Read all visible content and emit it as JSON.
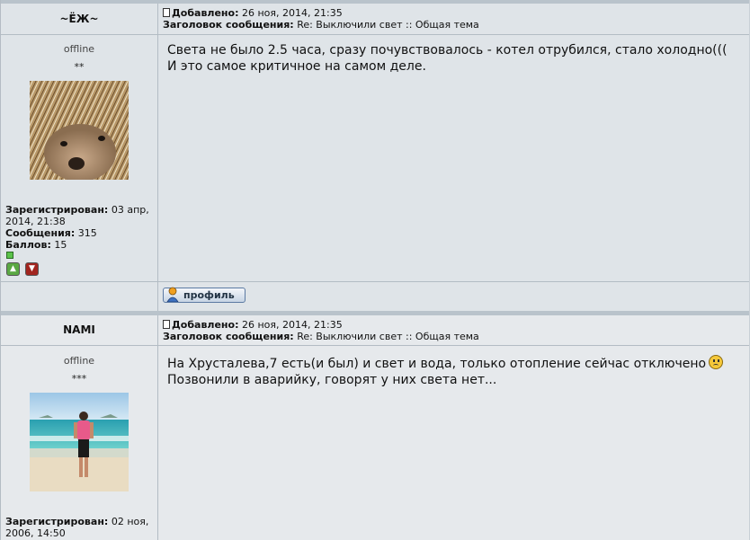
{
  "posts": [
    {
      "author": "~ЁЖ~",
      "status": "offline",
      "rank": "**",
      "added_label": "Добавлено:",
      "added_value": "26 ноя, 2014, 21:35",
      "subject_label": "Заголовок сообщения:",
      "subject_value": "Re: Выключили свет :: Общая тема",
      "body_lines": [
        "Света не было 2.5 часа, сразу почувствовалось - котел отрубился, стало холодно(((",
        "И это самое критичное на самом деле."
      ],
      "registered_label": "Зарегистрирован:",
      "registered_value": "03 апр, 2014, 21:38",
      "messages_label": "Сообщения:",
      "messages_value": "315",
      "points_label": "Баллов:",
      "points_value": "15",
      "profile_button": "профиль"
    },
    {
      "author": "NAMI",
      "status": "offline",
      "rank": "***",
      "added_label": "Добавлено:",
      "added_value": "26 ноя, 2014, 21:35",
      "subject_label": "Заголовок сообщения:",
      "subject_value": "Re: Выключили свет :: Общая тема",
      "body_lines": [
        "На Хрусталева,7 есть(и был) и свет и вода, только отопление сейчас отключено",
        "Позвонили в аварийку, говорят у них света нет..."
      ],
      "registered_label": "Зарегистрирован:",
      "registered_value": "02 ноя, 2006, 14:50"
    }
  ]
}
